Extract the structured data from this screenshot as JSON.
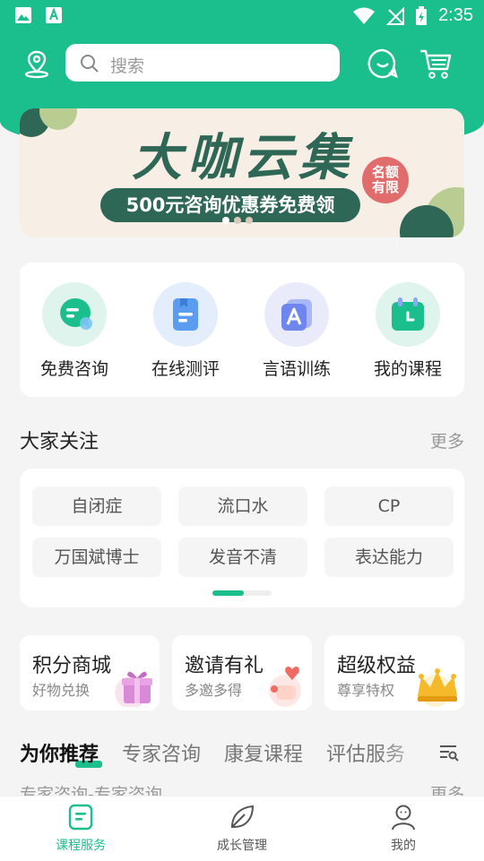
{
  "status": {
    "time": "2:35"
  },
  "search": {
    "placeholder": "搜索"
  },
  "banner": {
    "title": "大咖云集",
    "subtitle": "500元咨询优惠券免费领",
    "badge_line1": "名额",
    "badge_line2": "有限"
  },
  "services": [
    {
      "label": "免费咨询",
      "icon": "chat-bubble-icon",
      "bg": "#dff4ec",
      "color": "#1abf8d"
    },
    {
      "label": "在线测评",
      "icon": "document-icon",
      "bg": "#e4edfb",
      "color": "#5a9cf0"
    },
    {
      "label": "言语训练",
      "icon": "letter-a-icon",
      "bg": "#e9ebfb",
      "color": "#6f86ef"
    },
    {
      "label": "我的课程",
      "icon": "calendar-icon",
      "bg": "#dff4ec",
      "color": "#1abf8d"
    }
  ],
  "attention": {
    "title": "大家关注",
    "more": "更多",
    "tags": [
      "自闭症",
      "流口水",
      "CP",
      "万国斌博士",
      "发音不清",
      "表达能力"
    ]
  },
  "promos": [
    {
      "title": "积分商城",
      "subtitle": "好物兑换",
      "icon": "gift-icon"
    },
    {
      "title": "邀请有礼",
      "subtitle": "多邀多得",
      "icon": "heart-hand-icon"
    },
    {
      "title": "超级权益",
      "subtitle": "尊享特权",
      "icon": "crown-icon"
    }
  ],
  "tabs": [
    "为你推荐",
    "专家咨询",
    "康复课程",
    "评估服务"
  ],
  "peek": {
    "title": "专家咨询-专家咨询",
    "more": "更多"
  },
  "nav": [
    {
      "label": "课程服务",
      "active": true
    },
    {
      "label": "成长管理",
      "active": false
    },
    {
      "label": "我的",
      "active": false
    }
  ],
  "colors": {
    "brand": "#1abf8d",
    "banner_dark": "#2f6756"
  }
}
